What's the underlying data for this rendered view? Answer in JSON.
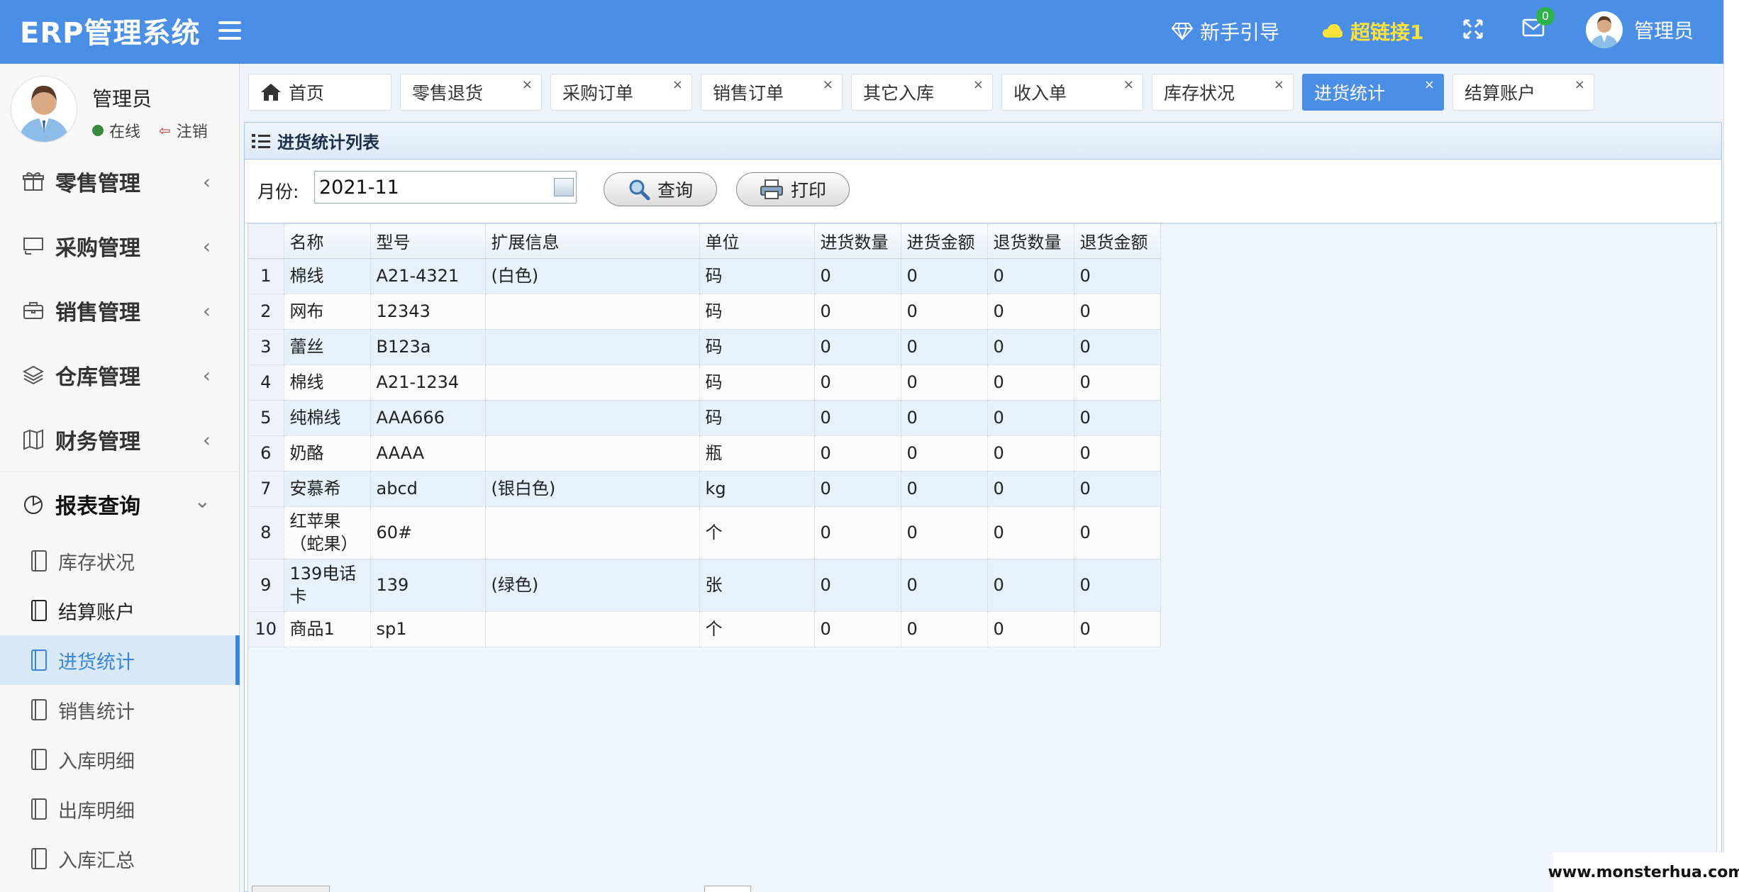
{
  "header": {
    "brand": "ERP管理系统",
    "guide_label": "新手引导",
    "link_label": "超链接1",
    "mail_badge": "0",
    "user_name": "管理员"
  },
  "profile": {
    "name": "管理员",
    "status": "在线",
    "logout": "注销"
  },
  "sidebar": {
    "menus": [
      {
        "label": "零售管理",
        "icon": "gift-icon"
      },
      {
        "label": "采购管理",
        "icon": "screen-icon"
      },
      {
        "label": "销售管理",
        "icon": "briefcase-icon"
      },
      {
        "label": "仓库管理",
        "icon": "layers-icon"
      },
      {
        "label": "财务管理",
        "icon": "map-book-icon"
      }
    ],
    "report": {
      "label": "报表查询",
      "icon": "pie-chart-icon"
    },
    "sub_items": [
      "库存状况",
      "结算账户",
      "进货统计",
      "销售统计",
      "入库明细",
      "出库明细",
      "入库汇总"
    ]
  },
  "tabs": [
    {
      "label": "首页"
    },
    {
      "label": "零售退货"
    },
    {
      "label": "采购订单"
    },
    {
      "label": "销售订单"
    },
    {
      "label": "其它入库"
    },
    {
      "label": "收入单"
    },
    {
      "label": "库存状况"
    },
    {
      "label": "进货统计"
    },
    {
      "label": "结算账户"
    }
  ],
  "panel": {
    "title": "进货统计列表",
    "month_label": "月份:",
    "month_value": "2021-11",
    "query_label": "查询",
    "print_label": "打印"
  },
  "table": {
    "columns": [
      "名称",
      "型号",
      "扩展信息",
      "单位",
      "进货数量",
      "进货金额",
      "退货数量",
      "退货金额"
    ],
    "rows": [
      {
        "rn": "1",
        "name": "棉线",
        "model": "A21-4321",
        "ext": "(白色)",
        "unit": "码",
        "in_qty": "0",
        "in_amt": "0",
        "ret_qty": "0",
        "ret_amt": "0"
      },
      {
        "rn": "2",
        "name": "网布",
        "model": "12343",
        "ext": "",
        "unit": "码",
        "in_qty": "0",
        "in_amt": "0",
        "ret_qty": "0",
        "ret_amt": "0"
      },
      {
        "rn": "3",
        "name": "蕾丝",
        "model": "B123a",
        "ext": "",
        "unit": "码",
        "in_qty": "0",
        "in_amt": "0",
        "ret_qty": "0",
        "ret_amt": "0"
      },
      {
        "rn": "4",
        "name": "棉线",
        "model": "A21-1234",
        "ext": "",
        "unit": "码",
        "in_qty": "0",
        "in_amt": "0",
        "ret_qty": "0",
        "ret_amt": "0"
      },
      {
        "rn": "5",
        "name": "纯棉线",
        "model": "AAA666",
        "ext": "",
        "unit": "码",
        "in_qty": "0",
        "in_amt": "0",
        "ret_qty": "0",
        "ret_amt": "0"
      },
      {
        "rn": "6",
        "name": "奶酪",
        "model": "AAAA",
        "ext": "",
        "unit": "瓶",
        "in_qty": "0",
        "in_amt": "0",
        "ret_qty": "0",
        "ret_amt": "0"
      },
      {
        "rn": "7",
        "name": "安慕希",
        "model": "abcd",
        "ext": "(银白色)",
        "unit": "kg",
        "in_qty": "0",
        "in_amt": "0",
        "ret_qty": "0",
        "ret_amt": "0"
      },
      {
        "rn": "8",
        "name": "红苹果（蛇果）",
        "model": "60#",
        "ext": "",
        "unit": "个",
        "in_qty": "0",
        "in_amt": "0",
        "ret_qty": "0",
        "ret_amt": "0"
      },
      {
        "rn": "9",
        "name": "139电话卡",
        "model": "139",
        "ext": "(绿色)",
        "unit": "张",
        "in_qty": "0",
        "in_amt": "0",
        "ret_qty": "0",
        "ret_amt": "0"
      },
      {
        "rn": "10",
        "name": "商品1",
        "model": "sp1",
        "ext": "",
        "unit": "个",
        "in_qty": "0",
        "in_amt": "0",
        "ret_qty": "0",
        "ret_amt": "0"
      }
    ]
  },
  "watermark": "www.monsterhua.com",
  "colors": {
    "accent": "#4a8ee6",
    "link_yellow": "#ffe23a",
    "online_green": "#3a8a3a"
  }
}
